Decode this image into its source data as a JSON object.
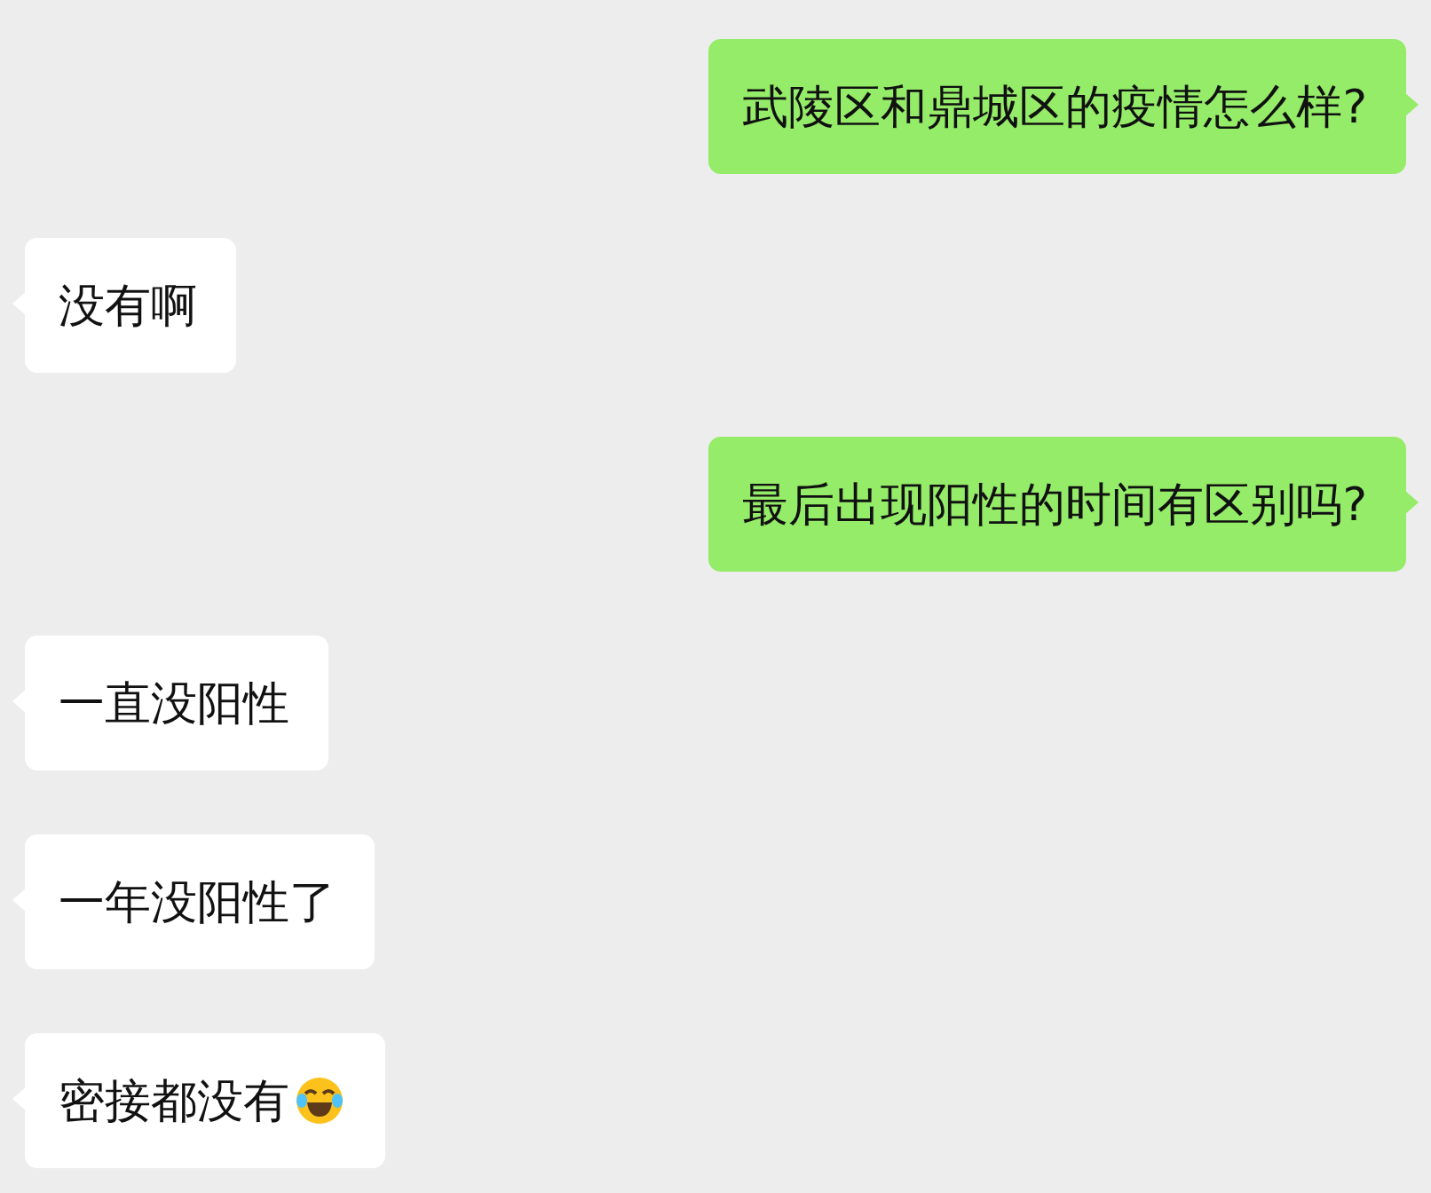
{
  "messages": [
    {
      "kind": "sent",
      "text": "武陵区和鼎城区的疫情怎么样?"
    },
    {
      "kind": "received",
      "text": "没有啊"
    },
    {
      "kind": "sent",
      "text": "最后出现阳性的时间有区别吗?"
    },
    {
      "kind": "received",
      "text": "一直没阳性"
    },
    {
      "kind": "received",
      "text": "一年没阳性了"
    },
    {
      "kind": "received",
      "text": "密接都没有",
      "emoji": true
    }
  ]
}
